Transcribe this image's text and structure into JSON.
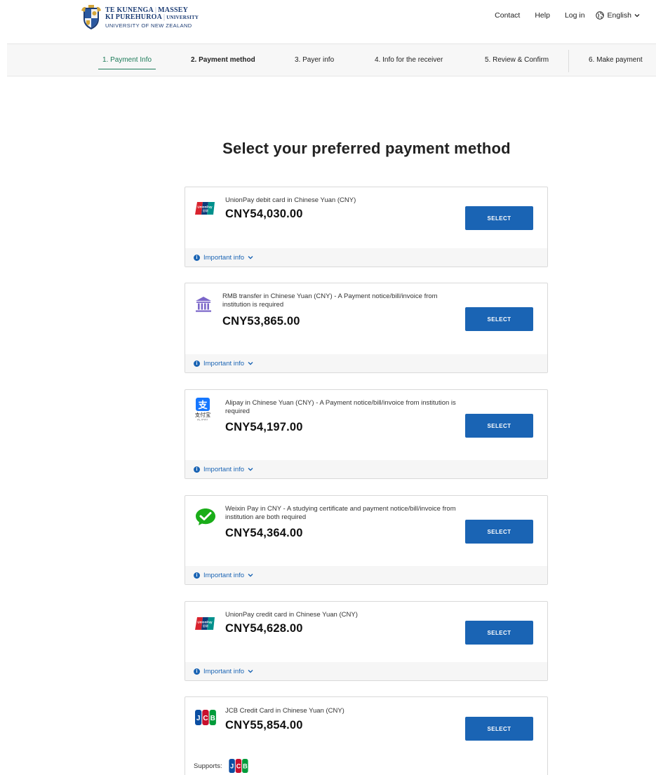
{
  "header": {
    "logo": {
      "line1_left": "TE KUNENGA",
      "line1_right": "MASSEY",
      "line2_left": "KI PUREHUROA",
      "line2_right": "UNIVERSITY",
      "line3": "UNIVERSITY OF NEW ZEALAND"
    },
    "nav": {
      "contact": "Contact",
      "help": "Help",
      "login": "Log in",
      "language": "English"
    }
  },
  "steps": [
    {
      "label": "1. Payment Info",
      "state": "completed"
    },
    {
      "label": "2. Payment method",
      "state": "current"
    },
    {
      "label": "3. Payer info",
      "state": "upcoming"
    },
    {
      "label": "4. Info for the receiver",
      "state": "upcoming"
    },
    {
      "label": "5. Review & Confirm",
      "state": "upcoming"
    },
    {
      "label": "6. Make payment",
      "state": "upcoming"
    }
  ],
  "page_title": "Select your preferred payment method",
  "payment_options": [
    {
      "icon": "unionpay-icon",
      "description": "UnionPay debit card in Chinese Yuan (CNY)",
      "amount": "CNY54,030.00",
      "button_label": "SELECT",
      "info_label": "Important info"
    },
    {
      "icon": "bank-icon",
      "description": "RMB transfer in Chinese Yuan (CNY) - A Payment notice/bill/invoice from institution is required",
      "amount": "CNY53,865.00",
      "button_label": "SELECT",
      "info_label": "Important info"
    },
    {
      "icon": "alipay-icon",
      "description": "Alipay in Chinese Yuan (CNY) - A Payment notice/bill/invoice from institution is required",
      "amount": "CNY54,197.00",
      "button_label": "SELECT",
      "info_label": "Important info"
    },
    {
      "icon": "weixin-pay-icon",
      "description": "Weixin Pay in CNY - A studying certificate and payment notice/bill/invoice from institution are both required",
      "amount": "CNY54,364.00",
      "button_label": "SELECT",
      "info_label": "Important info"
    },
    {
      "icon": "unionpay-icon",
      "description": "UnionPay credit card in Chinese Yuan (CNY)",
      "amount": "CNY54,628.00",
      "button_label": "SELECT",
      "info_label": "Important info"
    },
    {
      "icon": "jcb-icon",
      "description": "JCB Credit Card in Chinese Yuan (CNY)",
      "amount": "CNY55,854.00",
      "button_label": "SELECT",
      "supports_label": "Supports:"
    }
  ],
  "colors": {
    "primary_button": "#1a64b4",
    "link_blue": "#1a64b4",
    "active_step": "#1d7b59",
    "brand_navy": "#1c3c74"
  }
}
